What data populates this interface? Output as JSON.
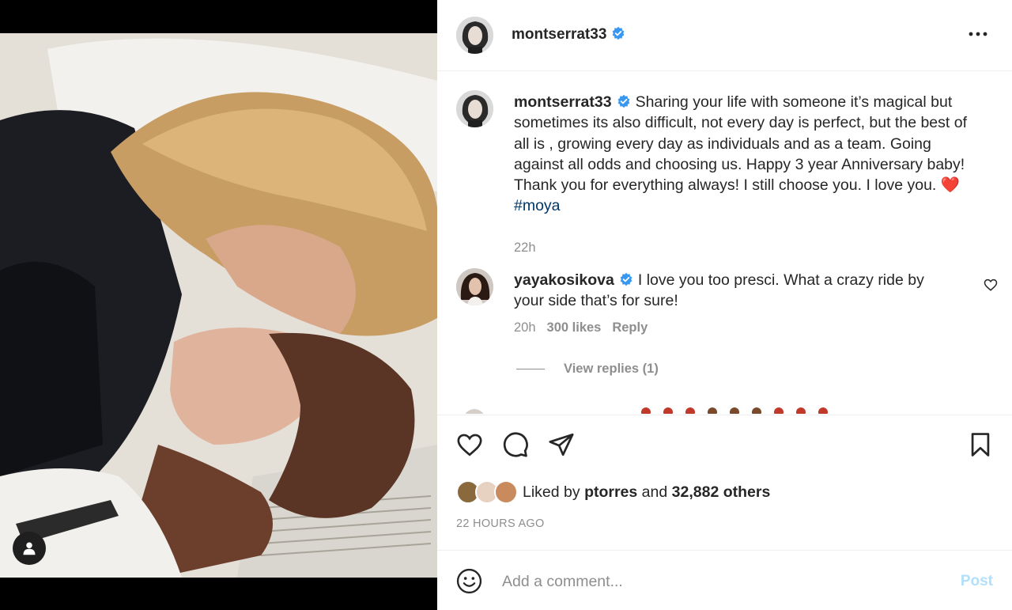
{
  "post": {
    "author": "montserrat33",
    "more_icon": "ellipsis-icon",
    "verified_icon": "verified-badge-icon",
    "verified_color": "#3897f0"
  },
  "caption": {
    "username": "montserrat33",
    "text": "Sharing your life with someone it’s magical but sometimes its also difficult, not every day is perfect, but the best of all is , growing every day as individuals and as a team. Going against all odds and choosing us. Happy 3 year Anniversary baby! Thank you for everything always! I still choose you. I love you.",
    "emoji": "❤️",
    "hashtag": "#moya",
    "time": "22h"
  },
  "comment": {
    "username": "yayakosikova",
    "text": "I love you too presci. What a crazy ride by your side that’s for sure!",
    "time": "20h",
    "likes": "300 likes",
    "reply_label": "Reply",
    "view_replies": "View replies (1)"
  },
  "actions": {
    "like_icon": "heart-icon",
    "comment_icon": "comment-bubble-icon",
    "share_icon": "paper-plane-icon",
    "save_icon": "bookmark-icon"
  },
  "likes": {
    "prefix": "Liked by",
    "user": "ptorres",
    "connector": "and",
    "others": "32,882 others"
  },
  "timestamp": "22 HOURS AGO",
  "add_comment": {
    "placeholder": "Add a comment...",
    "post_label": "Post",
    "emoji_icon": "smiley-icon"
  },
  "colors": {
    "text": "#262626",
    "secondary": "#8e8e8e",
    "hashtag": "#00376b",
    "post_disabled": "#b2dffc"
  }
}
